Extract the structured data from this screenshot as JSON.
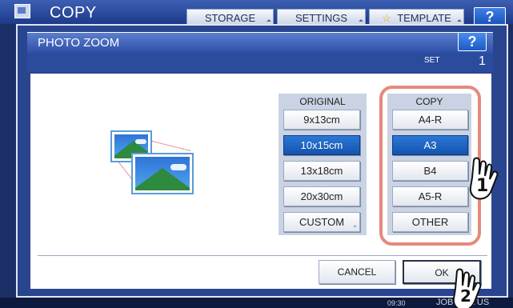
{
  "app": {
    "title": "COPY"
  },
  "top_nav": [
    {
      "label": "STORAGE"
    },
    {
      "label": "SETTINGS"
    },
    {
      "label": "TEMPLATE"
    }
  ],
  "help_label": "?",
  "dialog": {
    "title": "PHOTO ZOOM",
    "help_label": "?",
    "set_label": "SET",
    "set_value": "1",
    "original": {
      "header": "ORIGINAL",
      "options": [
        "9x13cm",
        "10x15cm",
        "13x18cm",
        "20x30cm",
        "CUSTOM"
      ],
      "selected": "10x15cm"
    },
    "copy": {
      "header": "COPY",
      "options": [
        "A4-R",
        "A3",
        "B4",
        "A5-R",
        "OTHER"
      ],
      "selected": "A3"
    },
    "cancel_label": "CANCEL",
    "ok_label": "OK"
  },
  "callouts": {
    "step1": "1",
    "step2": "2"
  },
  "status_bar": {
    "time": "09:30",
    "job_label": "JOB STATUS"
  },
  "colors": {
    "selected": "#1f66c7",
    "highlight_ring": "#e58a7c",
    "header": "#2b4b9d"
  }
}
